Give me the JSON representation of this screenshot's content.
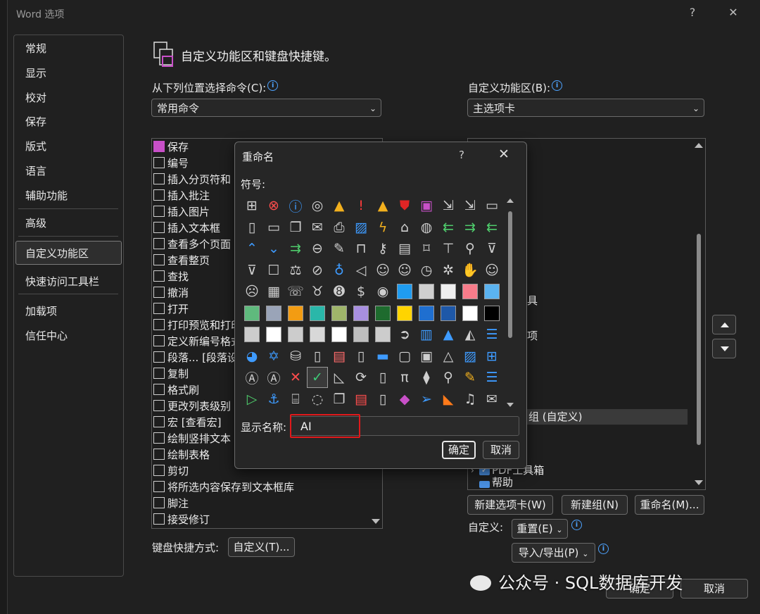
{
  "window": {
    "title": "Word 选项",
    "help": "?",
    "close": "✕"
  },
  "nav": {
    "items": [
      "常规",
      "显示",
      "校对",
      "保存",
      "版式",
      "语言",
      "辅助功能",
      "高级",
      "自定义功能区",
      "快速访问工具栏",
      "加载项",
      "信任中心"
    ],
    "active": "自定义功能区"
  },
  "header": {
    "title": "自定义功能区和键盘快捷键。"
  },
  "left": {
    "label": "从下列位置选择命令(C):",
    "select_value": "常用命令",
    "commands": [
      "保存",
      "编号",
      "插入分页符和",
      "插入批注",
      "插入图片",
      "插入文本框",
      "查看多个页面",
      "查看整页",
      "查找",
      "撤消",
      "打开",
      "打印预览和打印",
      "定义新编号格式",
      "段落... [段落设",
      "复制",
      "格式刷",
      "更改列表级别",
      "宏 [查看宏]",
      "绘制竖排文本",
      "绘制表格",
      "剪切",
      "将所选内容保存到文本框库",
      "脚注",
      "接受修订"
    ]
  },
  "right": {
    "label": "自定义功能区(B):",
    "select_value": "主选项卡",
    "tree_fragments": [
      "具",
      "项",
      "组 (自定义)",
      "PDF工具箱",
      "帮助"
    ],
    "buttons": {
      "new_tab": "新建选项卡(W)",
      "new_group": "新建组(N)",
      "rename": "重命名(M)..."
    },
    "customize_label": "自定义:",
    "reset": "重置(E)",
    "import_export": "导入/导出(P)"
  },
  "keyboard": {
    "label": "键盘快捷方式:",
    "button": "自定义(T)..."
  },
  "bottom": {
    "ok": "确定",
    "cancel": "取消"
  },
  "dialog": {
    "title": "重命名",
    "help": "?",
    "close": "✕",
    "symbols_label": "符号:",
    "display_name_label": "显示名称:",
    "display_name_value": "AI",
    "ok": "确定",
    "cancel": "取消",
    "symbols": [
      [
        "sitemap-icon",
        "close-circle-icon",
        "info-icon",
        "target-icon",
        "warning-icon",
        "exclamation-icon",
        "warning-icon",
        "shield-icon",
        "save-icon",
        "doc-arrow-icon",
        "doc-arrow-icon",
        "folder-icon"
      ],
      [
        "page-icon",
        "folder-icon",
        "copy-icon",
        "mail-icon",
        "printer-icon",
        "picture-icon",
        "lightning-icon",
        "home-icon",
        "palette-icon",
        "arrow-left-icon",
        "arrow-right-icon",
        "arrow-left-icon"
      ],
      [
        "chevron-up-icon",
        "chevron-down-icon",
        "arrow-right-icon",
        "back-circle-icon",
        "pin-icon",
        "lock-icon",
        "key-icon",
        "scroll-icon",
        "bookmark-icon",
        "presentation-icon",
        "search-icon",
        "filter-icon"
      ],
      [
        "filter-icon",
        "id-icon",
        "scale-icon",
        "link-icon",
        "mic-icon",
        "mute-icon",
        "user-icon",
        "user-icon",
        "clock-icon",
        "snowflake-icon",
        "hand-icon",
        "smile-icon"
      ],
      [
        "sad-icon",
        "calculator-icon",
        "phone-icon",
        "piggy-bank-icon",
        "number-8-icon",
        "dollar-icon",
        "eye-icon",
        "dash-icon",
        "grid-icon",
        "square-icon",
        "square-icon",
        "square-icon"
      ],
      [
        "square-icon",
        "square-icon",
        "square-icon",
        "square-icon",
        "square-icon",
        "square-icon",
        "square-icon",
        "square-icon",
        "square-icon",
        "square-icon",
        "square-icon",
        "square-icon"
      ],
      [
        "square-icon",
        "square-icon",
        "square-icon",
        "square-icon",
        "square-icon",
        "square-icon",
        "square-icon",
        "arrow-circle-icon",
        "chart-icon",
        "triangle-icon",
        "mountain-icon",
        "bars-icon"
      ],
      [
        "pie-icon",
        "network-icon",
        "database-icon",
        "document-icon",
        "film-icon",
        "device-icon",
        "image-icon",
        "frame-icon",
        "monitor-icon",
        "cone-icon",
        "picture-icon",
        "shapes-icon"
      ],
      [
        "text-box-icon",
        "text-box-icon",
        "x-icon",
        "check-icon",
        "ruler-icon",
        "refresh-icon",
        "code-icon",
        "pi-icon",
        "paint-icon",
        "search-icon",
        "brush-icon",
        "list-icon"
      ],
      [
        "play-icon",
        "anchor-icon",
        "clipboard-icon",
        "shape-add-icon",
        "copy-icon",
        "list-alert-icon",
        "page-icon",
        "eraser-icon",
        "send-icon",
        "gradient-icon",
        "bell-icon",
        "envelope-icon"
      ]
    ],
    "swatches": {
      "r4": [
        "#1f9cf0",
        "#cfcfcf",
        "#efefef",
        "#f77c8a",
        "#5bb3f0"
      ],
      "r5": [
        "#5fba7d",
        "#9aa4b8",
        "#f39c12",
        "#2ab7a9",
        "#9fb56a",
        "#a88fe0",
        "#1e6b2e",
        "#ffd400",
        "#1f6fd0",
        "#1e58a8",
        "#ffffff",
        "#000000"
      ],
      "r6": [
        "#cccccc",
        "#ffffff",
        "#cccccc",
        "#d8d8d8",
        "#ffffff",
        "#bfbfbf",
        "#cccccc"
      ]
    }
  },
  "watermark": {
    "text": "公众号 · SQL数据库开发"
  }
}
